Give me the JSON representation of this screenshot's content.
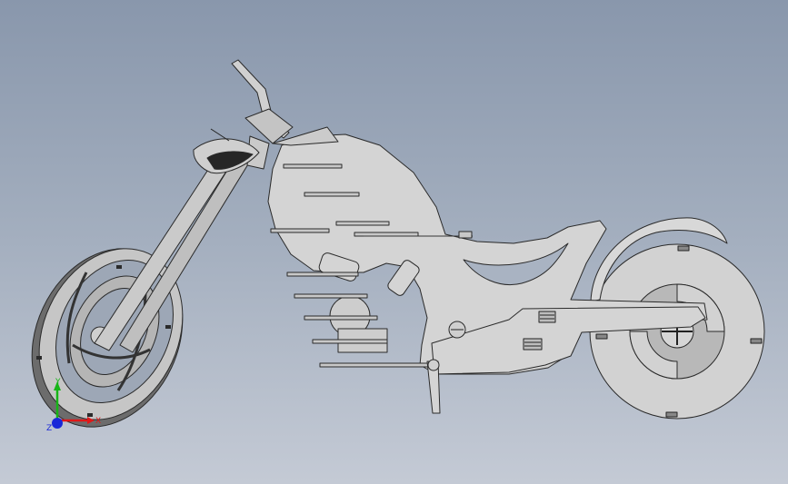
{
  "viewport": {
    "background_top": "#8997ac",
    "background_bottom": "#c4cad5"
  },
  "model": {
    "part_fill": "#d4d4d4",
    "part_stroke": "#2a2a2a",
    "dark_fill": "#3c3c3c"
  },
  "triad": {
    "x_label": "X",
    "y_label": "Y",
    "z_label": "Z",
    "x_color": "#e01818",
    "y_color": "#17b517",
    "z_color": "#1a28d8"
  }
}
